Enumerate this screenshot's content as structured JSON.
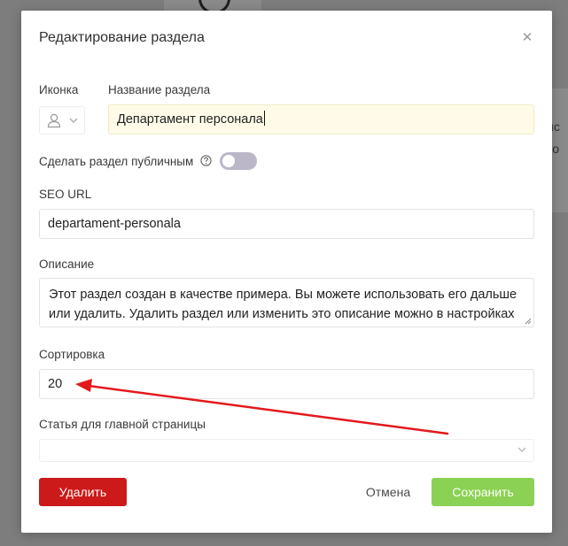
{
  "background": {
    "side_text": [
      "ис",
      "то"
    ]
  },
  "modal": {
    "title": "Редактирование раздела",
    "close_icon": "close-icon"
  },
  "form": {
    "icon_label": "Иконка",
    "icon_value": "user-icon",
    "name_label": "Название раздела",
    "name_value": "Департамент персонала",
    "public_label": "Сделать раздел публичным",
    "public_enabled": false,
    "seo_label": "SEO URL",
    "seo_value": "departament-personala",
    "description_label": "Описание",
    "description_value": "Этот раздел создан в качестве примера. Вы можете использовать его дальше или удалить. Удалить раздел или изменить это описание можно в настройках",
    "sort_label": "Сортировка",
    "sort_value": "20",
    "homepage_article_label": "Статья для главной страницы",
    "homepage_article_value": ""
  },
  "buttons": {
    "delete": "Удалить",
    "cancel": "Отмена",
    "save": "Сохранить"
  },
  "colors": {
    "delete": "#cc1a1a",
    "save": "#8bd153",
    "toggle_off": "#bbb7c9",
    "name_highlight": "#fffbe8",
    "annotation_arrow": "#e3191c"
  }
}
